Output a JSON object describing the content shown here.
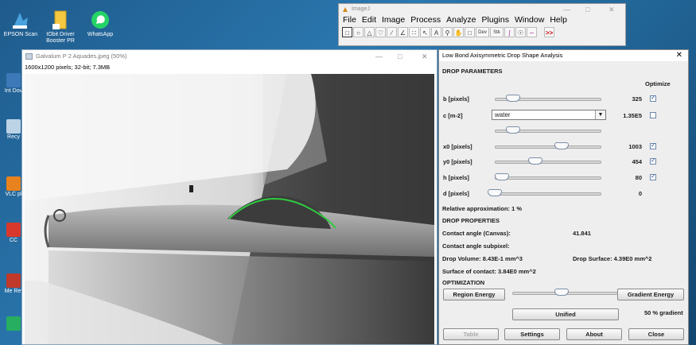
{
  "desktop": {
    "top_icons": [
      {
        "label": "EPSON Scan",
        "icon": "epson-scan-icon"
      },
      {
        "label": "IObit Driver Booster PR",
        "icon": "folder-icon"
      },
      {
        "label": "WhatsApp",
        "icon": "whatsapp-icon"
      }
    ],
    "left_icons": [
      {
        "label": "Int Dov",
        "icon": "app-icon"
      },
      {
        "label": "Recy",
        "icon": "recycle-bin-icon"
      },
      {
        "label": "VLC pl",
        "icon": "vlc-icon"
      },
      {
        "label": "CC",
        "icon": "app-icon"
      },
      {
        "label": "Me Ref",
        "icon": "app-icon"
      },
      {
        "label": "",
        "icon": "app-icon"
      }
    ]
  },
  "imagej": {
    "title": "ImageJ",
    "menu": [
      "File",
      "Edit",
      "Image",
      "Process",
      "Analyze",
      "Plugins",
      "Window",
      "Help"
    ],
    "tools": [
      "rectangle-tool-icon",
      "oval-tool-icon",
      "polygon-tool-icon",
      "freehand-tool-icon",
      "line-tool-icon",
      "angle-tool-icon",
      "point-tool-icon",
      "wand-tool-icon",
      "text-tool-icon",
      "magnifier-tool-icon",
      "hand-tool-icon",
      "dropper-tool-icon",
      "dev-tool-icon",
      "stk-tool-icon",
      "brush-tool-icon",
      "pencil-tool-icon",
      "spline-tool-icon",
      "more-tools-icon"
    ],
    "tool_labels": {
      "dev": "Dev",
      "stk": "Stk",
      "more": ">>"
    }
  },
  "image_window": {
    "title": "Galvalum P 2 Aquades.jpeg (50%)",
    "info": "1600x1200 pixels; 32-bit; 7.3MB"
  },
  "panel": {
    "title": "Low Bond Axisymmetric Drop Shape Analysis",
    "drop_parameters_heading": "DROP PARAMETERS",
    "optimize_label": "Optimize",
    "params": [
      {
        "label": "b [pixels]",
        "value": "325",
        "fraction": 0.17,
        "optimize": true
      },
      {
        "label": "x0 [pixels]",
        "value": "1003",
        "fraction": 0.63,
        "optimize": true
      },
      {
        "label": "y0 [pixels]",
        "value": "454",
        "fraction": 0.38,
        "optimize": true
      },
      {
        "label": "h [pixels]",
        "value": "80",
        "fraction": 0.07,
        "optimize": true
      },
      {
        "label": "d [pixels]",
        "value": "0",
        "fraction": 0.0,
        "optimize": null
      }
    ],
    "c_param": {
      "label": "c [m-2]",
      "combo_value": "water",
      "value": "1.35E5",
      "fraction": 0.17,
      "optimize": false
    },
    "relative_approx": "Relative approximation: 1 %",
    "drop_properties_heading": "DROP PROPERTIES",
    "contact_angle_label": "Contact angle (Canvas):",
    "contact_angle_value": "41.841",
    "contact_subpixel_label": "Contact angle subpixel:",
    "drop_volume": "Drop Volume: 8.43E-1 mm^3",
    "drop_surface": "Drop Surface: 4.39E0 mm^2",
    "surface_contact": "Surface of contact: 3.84E0 mm^2",
    "optimization_heading": "OPTIMIZATION",
    "region_energy": "Region Energy",
    "gradient_energy": "Gradient Energy",
    "optimization_fraction": 0.46,
    "unified": "Unified",
    "gradient_percent": "50 % gradient",
    "buttons": {
      "table": "Table",
      "settings": "Settings",
      "about": "About",
      "close": "Close"
    }
  }
}
